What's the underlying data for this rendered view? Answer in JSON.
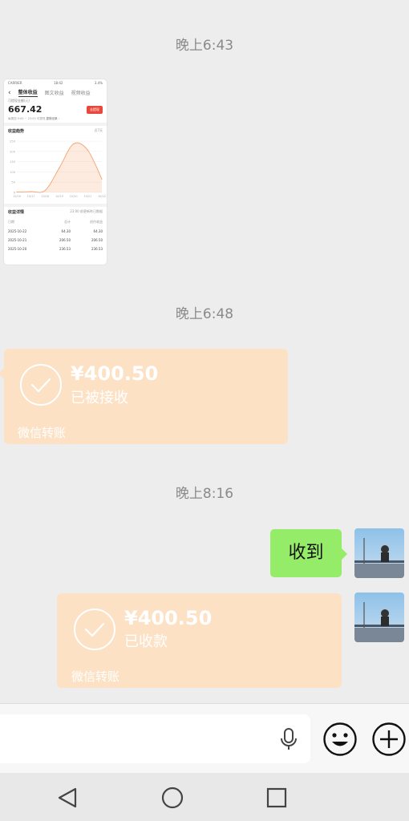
{
  "timestamps": [
    "晚上6:43",
    "晚上6:48",
    "晚上8:16"
  ],
  "thumbnail": {
    "status_left": "CARRIER",
    "status_time": "18:42",
    "status_right": "3.4%",
    "tabs": [
      "整体收益",
      "图文收益",
      "视频收益"
    ],
    "balance_label": "可提现金额(元)",
    "balance": "667.42",
    "withdraw_label": "去提现",
    "note": "每周四 9:00 ~ 23:00 可提现",
    "note_link": "提现记录",
    "trend_title": "收益趋势",
    "trend_range": "近7天",
    "detail_title": "收益详情",
    "detail_note": "23:00 前更新昨日数据",
    "table_headers": [
      "日期",
      "总计",
      "创作收益"
    ],
    "rows": [
      [
        "2025-10-22",
        "64.30",
        "64.30"
      ],
      [
        "2025-10-21",
        "206.50",
        "206.50"
      ],
      [
        "2025-10-20",
        "236.53",
        "236.53"
      ]
    ]
  },
  "chart_data": {
    "type": "area",
    "title": "收益趋势",
    "categories": [
      "10/16",
      "10/17",
      "10/18",
      "10/19",
      "10/20",
      "10/21",
      "10/22"
    ],
    "values": [
      2,
      4,
      10,
      120,
      236.53,
      206.5,
      64.3
    ],
    "y_ticks": [
      "0",
      "50",
      "100",
      "150",
      "200",
      "250"
    ],
    "ylim": [
      0,
      250
    ],
    "color": "#f4a36f"
  },
  "transfers": [
    {
      "amount": "¥400.50",
      "status": "已被接收",
      "footer": "微信转账"
    },
    {
      "amount": "¥400.50",
      "status": "已收款",
      "footer": "微信转账"
    }
  ],
  "message": {
    "text": "收到"
  },
  "colors": {
    "transfer_bg": "#fde1c5",
    "bubble_green": "#95ec69",
    "background": "#ededed"
  },
  "icons": {
    "voice": "microphone-icon",
    "emoji": "smiley-icon",
    "more": "plus-circle-icon",
    "nav_back": "triangle-back-icon",
    "nav_home": "circle-home-icon",
    "nav_recent": "square-recent-icon"
  }
}
